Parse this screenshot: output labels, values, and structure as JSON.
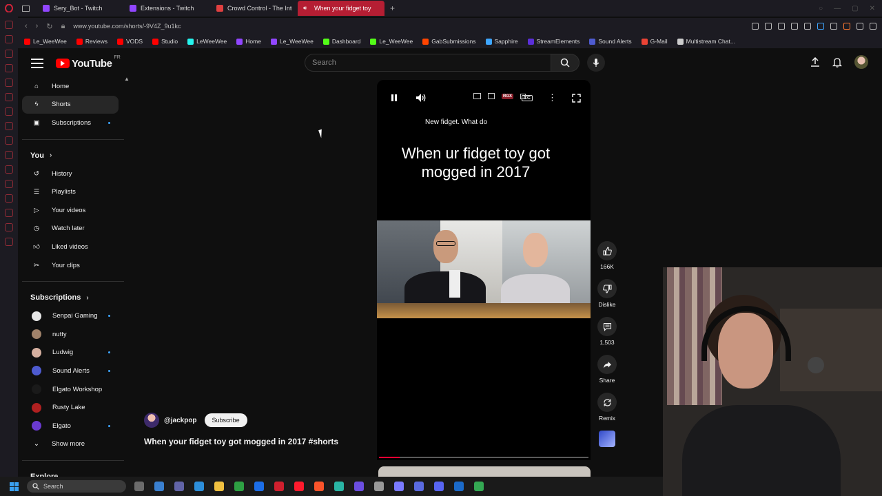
{
  "browser": {
    "tabs": [
      {
        "label": "Sery_Bot - Twitch",
        "color": "#9146ff",
        "active": false
      },
      {
        "label": "Extensions - Twitch",
        "color": "#9146ff",
        "active": false
      },
      {
        "label": "Crowd Control - The Inter",
        "color": "#e04040",
        "active": false
      },
      {
        "label": "When your fidget toy",
        "color": "#ffffff",
        "active": true
      }
    ],
    "new_tab": "+",
    "url": "www.youtube.com/shorts/-9V4Z_9u1kc",
    "bookmarks": [
      {
        "label": "Le_WeeWee",
        "color": "#ff0000"
      },
      {
        "label": "Reviews",
        "color": "#ff0000"
      },
      {
        "label": "VODS",
        "color": "#ff0000"
      },
      {
        "label": "Studio",
        "color": "#ff0000"
      },
      {
        "label": "LeWeeWee",
        "color": "#25f4ee"
      },
      {
        "label": "Home",
        "color": "#9146ff"
      },
      {
        "label": "Le_WeeWee",
        "color": "#9146ff"
      },
      {
        "label": "Dashboard",
        "color": "#53fc18"
      },
      {
        "label": "Le_WeeWee",
        "color": "#53fc18"
      },
      {
        "label": "GabSubmissions",
        "color": "#ff4500"
      },
      {
        "label": "Sapphire",
        "color": "#3ea6ff"
      },
      {
        "label": "StreamElements",
        "color": "#5b2fd9"
      },
      {
        "label": "Sound Alerts",
        "color": "#4e5bd0"
      },
      {
        "label": "G-Mail",
        "color": "#ea4335"
      },
      {
        "label": "Multistream Chat...",
        "color": "#cccccc"
      }
    ]
  },
  "youtube": {
    "logo_text": "YouTube",
    "country": "FR",
    "search_placeholder": "Search",
    "nav_main": [
      {
        "label": "Home",
        "icon": "home-icon",
        "active": false,
        "dot": false
      },
      {
        "label": "Shorts",
        "icon": "shorts-icon",
        "active": true,
        "dot": false
      },
      {
        "label": "Subscriptions",
        "icon": "subscriptions-icon",
        "active": false,
        "dot": true
      }
    ],
    "you_heading": "You",
    "nav_you": [
      {
        "label": "History",
        "icon": "history-icon"
      },
      {
        "label": "Playlists",
        "icon": "playlists-icon"
      },
      {
        "label": "Your videos",
        "icon": "your-videos-icon"
      },
      {
        "label": "Watch later",
        "icon": "watch-later-icon"
      },
      {
        "label": "Liked videos",
        "icon": "liked-videos-icon"
      },
      {
        "label": "Your clips",
        "icon": "clips-icon"
      }
    ],
    "subscriptions_heading": "Subscriptions",
    "subscriptions": [
      {
        "label": "Senpai Gaming",
        "color": "#e8e8e8",
        "dot": true
      },
      {
        "label": "nutty",
        "color": "#a0826a",
        "dot": false
      },
      {
        "label": "Ludwig",
        "color": "#d6b0a0",
        "dot": true
      },
      {
        "label": "Sound Alerts",
        "color": "#4e5bd0",
        "dot": true
      },
      {
        "label": "Elgato Workshop",
        "color": "#1a1a1a",
        "dot": false
      },
      {
        "label": "Rusty Lake",
        "color": "#b02020",
        "dot": false
      },
      {
        "label": "Elgato",
        "color": "#6a3ad0",
        "dot": true
      }
    ],
    "show_more": "Show more",
    "explore_heading": "Explore",
    "short": {
      "caption_small": "New fidget. What do",
      "caption_big": "When ur fidget toy got mogged in 2017",
      "channel": "@jackpop",
      "subscribe": "Subscribe",
      "title": "When your fidget toy got mogged in 2017 #shorts",
      "progress_percent": 10,
      "rgx_badge": "RGX",
      "cc_badge": "CC"
    },
    "actions": {
      "likes": "166K",
      "dislike": "Dislike",
      "comments": "1,503",
      "share": "Share",
      "remix": "Remix"
    }
  },
  "taskbar": {
    "search_placeholder": "Search",
    "apps": [
      "#6b6b6b",
      "#3a80d0",
      "#6264a7",
      "#2d8fdb",
      "#f0c040",
      "#2ea043",
      "#1c6ee8",
      "#d0202e",
      "#ff1b2d",
      "#fb542b",
      "#2ab5a5",
      "#6b4ee0",
      "#999999",
      "#7a7aff",
      "#5a6ae0",
      "#5865f2",
      "#1b6ac9",
      "#34a853"
    ]
  }
}
